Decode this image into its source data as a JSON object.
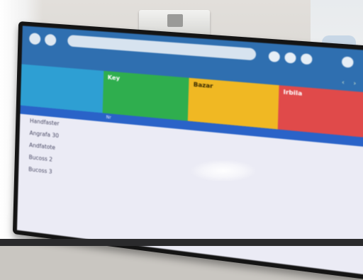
{
  "browser": {
    "url": "",
    "tool_icons": [
      "refresh-icon",
      "star-icon",
      "menu-icon",
      "user-icon"
    ]
  },
  "header": {
    "title": "",
    "prev_arrow": "‹",
    "next_arrow": "›"
  },
  "cards": [
    {
      "name": "",
      "lines": [
        "",
        "",
        ""
      ],
      "color": "#2e9fd3"
    },
    {
      "name": "Key",
      "lines": [
        "",
        "",
        ""
      ],
      "color": "#2fae4e"
    },
    {
      "name": "Bazar",
      "lines": [
        "",
        "",
        ""
      ],
      "color": "#f0b823"
    },
    {
      "name": "Irbila",
      "lines": [
        "",
        "",
        ""
      ],
      "color": "#e04a4a"
    }
  ],
  "table": {
    "columns": [
      "Nr",
      "",
      "",
      ""
    ],
    "rows": [
      {
        "label": "Handfaster",
        "v1": "",
        "v2": "",
        "v3": ""
      },
      {
        "label": "Angrafa 30",
        "v1": "",
        "v2": "",
        "v3": ""
      },
      {
        "label": "Andfatote",
        "v1": "",
        "v2": "",
        "v3": ""
      },
      {
        "label": "Bucoss 2",
        "v1": "",
        "v2": "",
        "v3": ""
      },
      {
        "label": "Bucoss 3",
        "v1": "",
        "v2": "",
        "v3": ""
      }
    ]
  },
  "colors": {
    "browser_bar": "#2f6fb0",
    "title_text": "#9de08c",
    "table_header": "#2a63c8"
  }
}
